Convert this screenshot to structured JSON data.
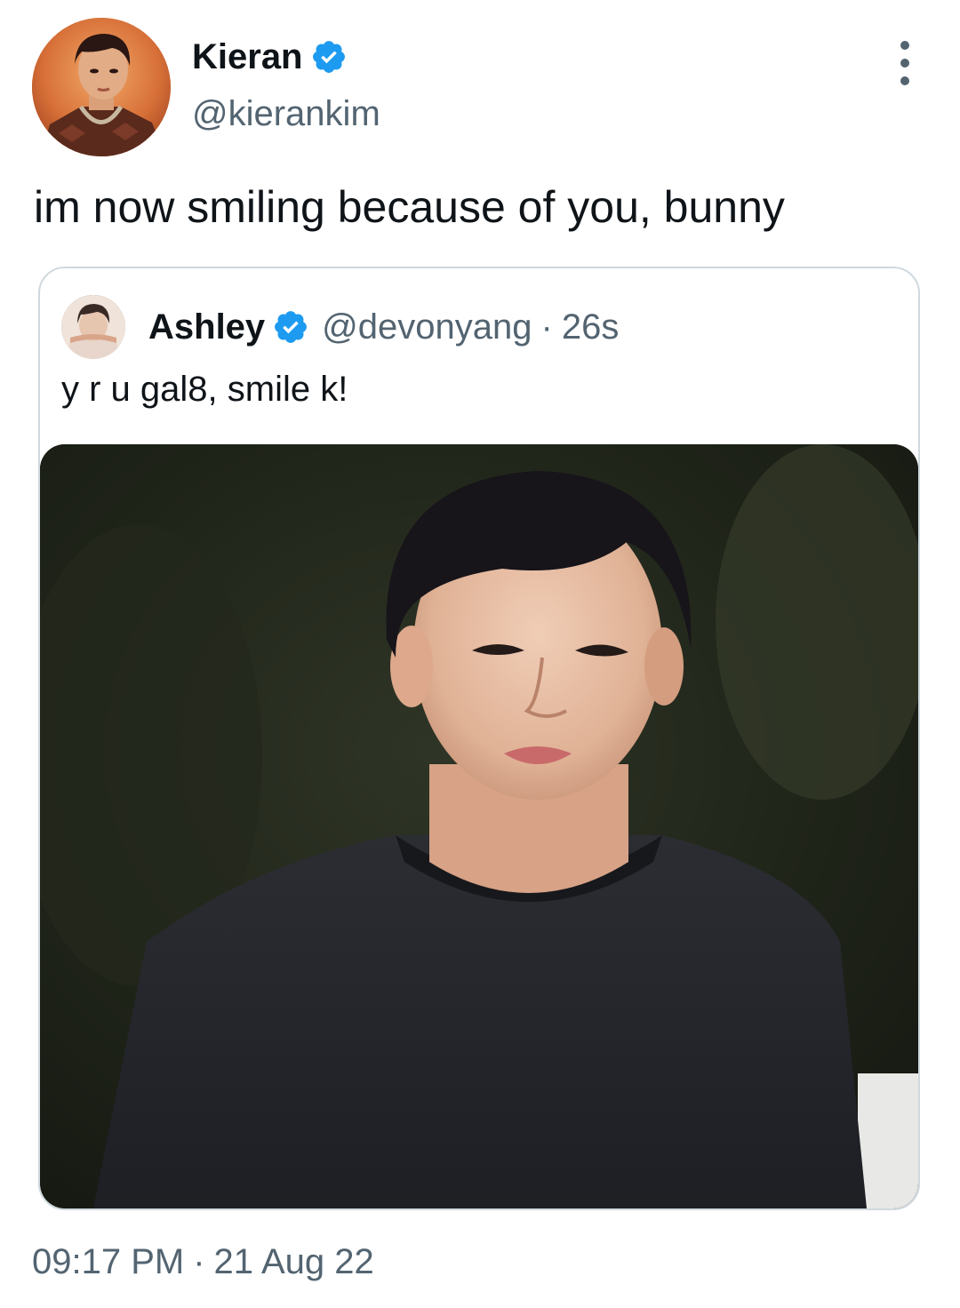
{
  "tweet": {
    "author": {
      "display_name": "Kieran",
      "handle": "@kierankim",
      "verified": true
    },
    "text": "im now smiling because of you, bunny",
    "quoted": {
      "author": {
        "display_name": "Ashley",
        "handle": "@devonyang",
        "verified": true
      },
      "separator": "·",
      "relative_time": "26s",
      "text": "y r u gal8, smile k!"
    },
    "time": "09:17 PM",
    "separator": "·",
    "date": "21 Aug 22"
  },
  "colors": {
    "text_primary": "#0f1419",
    "text_secondary": "#536471",
    "verified_blue": "#1d9bf0",
    "border": "#cfd9de"
  },
  "icons": {
    "verified": "verified-badge-icon",
    "more": "more-vertical-icon"
  }
}
